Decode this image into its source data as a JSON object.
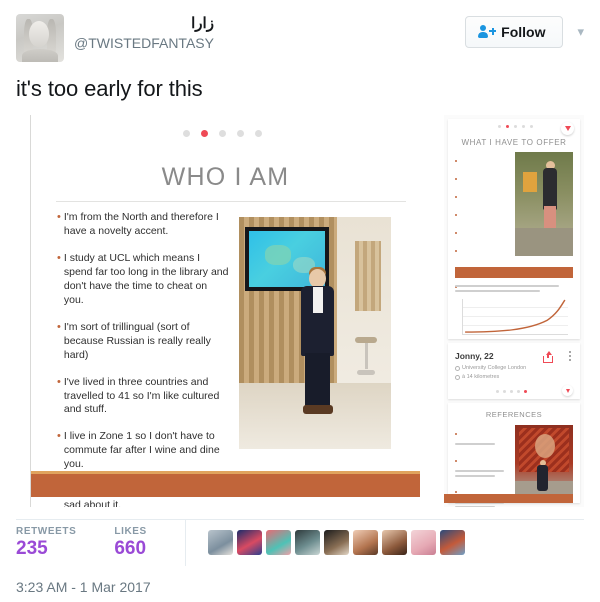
{
  "header": {
    "display_name": "زارا",
    "handle": "@TWISTEDFANTASY",
    "follow_label": "Follow",
    "follow_icon": "person-plus-icon",
    "caret_icon": "chevron-down-icon",
    "avatar_alt": "profile-avatar"
  },
  "tweet": {
    "text": "it's too early for this",
    "timestamp": "3:23 AM - 1 Mar 2017"
  },
  "media": {
    "carousel": {
      "total_dots": 5,
      "active_index": 1
    },
    "download_icon": "download-arrow-icon",
    "slide": {
      "title": "WHO I AM",
      "bullet_marker": "•",
      "bullets": [
        "I'm from the North and therefore I have a novelty accent.",
        "I study at UCL which means I spend far too long in the library and don't have the time to cheat on you.",
        "I'm sort of trillingual (sort of because Russian is really really hard)",
        "I've lived in three countries and travelled to 41 so I'm like cultured and stuff.",
        "I live in Zone 1 so I don't have to commute far after I wine and dine you.",
        "I voted against Brexit and I'm still sad about it."
      ],
      "photo_alt": "man-in-suit-photo",
      "accent_color": "#c1653a"
    }
  },
  "panel": {
    "slide_offer": {
      "title": "WHAT I HAVE TO OFFER",
      "bullet_count": 8,
      "photo_alt": "person-outdoors-photo",
      "caption": "This graph shows my expected attractiveness over time, with the x-axis being time and the y-axis being my hotness.",
      "chart_alt": "exponential-curve-chart"
    },
    "profile": {
      "name": "Jonny, 22",
      "school": "University College London",
      "distance": "à 14 kilometres",
      "school_icon": "graduation-cap-icon",
      "distance_icon": "location-pin-icon",
      "share_icon": "share-icon",
      "more_icon": "more-options-icon",
      "download_icon": "download-arrow-icon",
      "dots_total": 5,
      "dots_active": 4
    },
    "slide_references": {
      "title": "REFERENCES",
      "quotes": [
        "\"What a wonderful catch\" - My Mum",
        "\"We need someone to team up with to abuse him\" - My Housemates",
        "\"He's really great at seizing the means of production\" - This mural of Lenin"
      ],
      "photo_alt": "lenin-mural-photo"
    }
  },
  "stats": {
    "retweets_label": "RETWEETS",
    "retweets_value": "235",
    "likes_label": "LIKES",
    "likes_value": "660",
    "value_color": "#9a4ad6",
    "liker_count": 9
  }
}
